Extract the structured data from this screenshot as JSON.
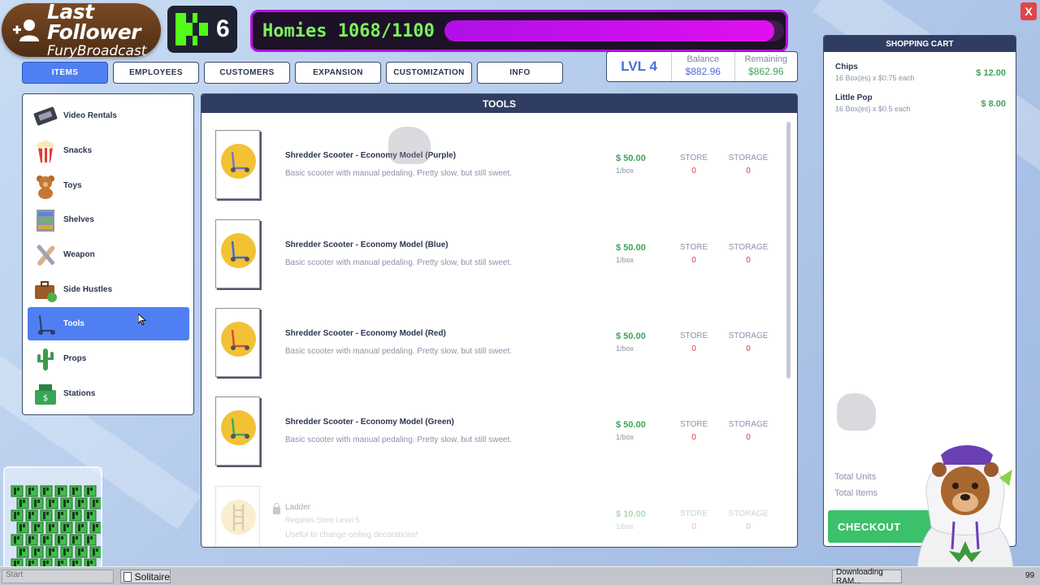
{
  "overlay": {
    "follower_title": "Last Follower",
    "follower_name": "FuryBroadcast",
    "kick_count": "6",
    "homies_label": "Homies 1068/1100",
    "homies_progress": 0.971,
    "close_label": "X"
  },
  "tabs": [
    {
      "label": "ITEMS",
      "active": true
    },
    {
      "label": "EMPLOYEES"
    },
    {
      "label": "CUSTOMERS"
    },
    {
      "label": "EXPANSION"
    },
    {
      "label": "CUSTOMIZATION"
    },
    {
      "label": "INFO"
    }
  ],
  "stats": {
    "level": "LVL 4",
    "balance_label": "Balance",
    "balance_value": "$882.96",
    "remaining_label": "Remaining",
    "remaining_value": "$862.96"
  },
  "categories": [
    {
      "label": "Video Rentals",
      "icon": "vhs-tape-icon"
    },
    {
      "label": "Snacks",
      "icon": "popcorn-icon"
    },
    {
      "label": "Toys",
      "icon": "teddy-bear-icon"
    },
    {
      "label": "Shelves",
      "icon": "shelves-icon"
    },
    {
      "label": "Weapon",
      "icon": "bat-icon"
    },
    {
      "label": "Side Hustles",
      "icon": "briefcase-icon"
    },
    {
      "label": "Tools",
      "icon": "scooter-icon",
      "active": true
    },
    {
      "label": "Props",
      "icon": "cactus-icon"
    },
    {
      "label": "Stations",
      "icon": "cash-register-icon"
    }
  ],
  "tools": {
    "header": "TOOLS",
    "store_label": "STORE",
    "storage_label": "STORAGE",
    "items": [
      {
        "name": "Shredder Scooter - Economy Model (Purple)",
        "desc": "Basic scooter with manual pedaling. Pretty slow, but still sweet.",
        "price": "$ 50.00",
        "unit": "1/box",
        "store": "0",
        "storage": "0",
        "color": "#7d6fc9"
      },
      {
        "name": "Shredder Scooter - Economy Model (Blue)",
        "desc": "Basic scooter with manual pedaling. Pretty slow, but still sweet.",
        "price": "$ 50.00",
        "unit": "1/box",
        "store": "0",
        "storage": "0",
        "color": "#3f6bd4"
      },
      {
        "name": "Shredder Scooter - Economy Model (Red)",
        "desc": "Basic scooter with manual pedaling. Pretty slow, but still sweet.",
        "price": "$ 50.00",
        "unit": "1/box",
        "store": "0",
        "storage": "0",
        "color": "#d24a4a"
      },
      {
        "name": "Shredder Scooter - Economy Model (Green)",
        "desc": "Basic scooter with manual pedaling. Pretty slow, but still sweet.",
        "price": "$ 50.00",
        "unit": "1/box",
        "store": "0",
        "storage": "0",
        "color": "#3da866"
      },
      {
        "name": "Ladder",
        "requirement": "Requires Store Level 5",
        "desc": "Useful to change ceiling decorations!",
        "price": "$ 10.00",
        "unit": "1/box",
        "store": "0",
        "storage": "0",
        "locked": true
      }
    ]
  },
  "cart": {
    "header": "SHOPPING CART",
    "items": [
      {
        "name": "Chips",
        "detail": "16 Box(es) x $0.75 each",
        "price": "$ 12.00"
      },
      {
        "name": "Little Pop",
        "detail": "16 Box(es) x $0.5 each",
        "price": "$ 8.00"
      }
    ],
    "total_units_label": "Total Units",
    "total_items_label": "Total Items",
    "checkout_label": "CHECKOUT"
  },
  "taskbar": {
    "start_text": "Start",
    "solitaire_label": "Solitaire",
    "download_label": "Downloading RAM...",
    "right_num": "99"
  },
  "colors": {
    "accent": "#4f7ff2",
    "header_bg": "#2f3d62",
    "price_green": "#3fa35a",
    "zero_red": "#d63c3c",
    "homies_text": "#7cf25c",
    "homies_bar": "#c912ea"
  }
}
